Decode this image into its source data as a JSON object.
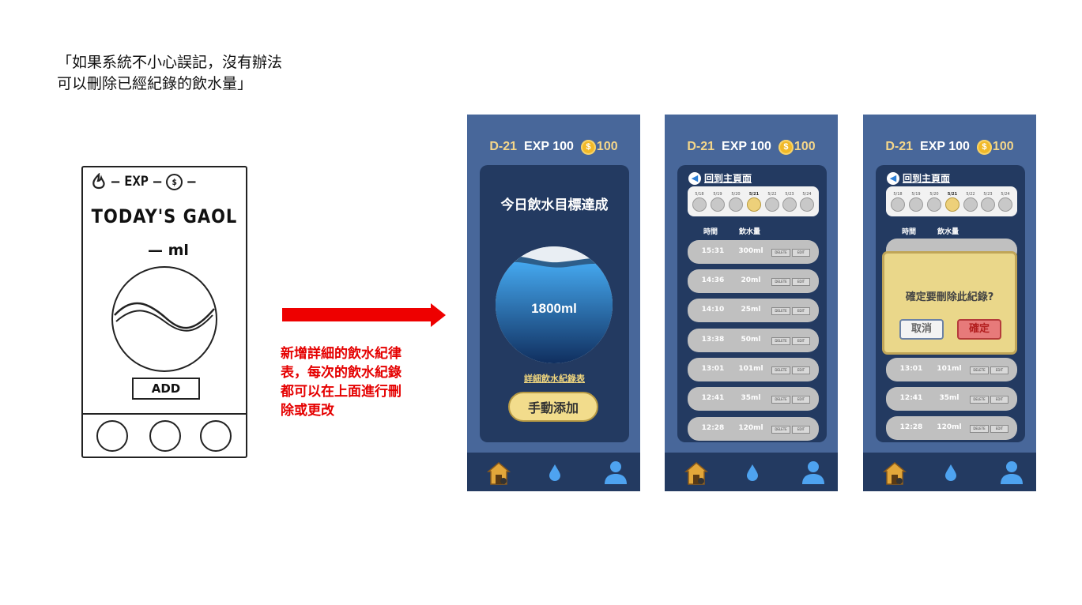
{
  "quote": "「如果系統不小心誤記，沒有辦法\n可以刪除已經紀錄的飲水量」",
  "sketch": {
    "top_bar": [
      "—",
      "EXP",
      "—",
      "—"
    ],
    "coin_symbol": "$",
    "title": "TODAY'S GAOL",
    "goal_unit": "— ml",
    "add_label": "ADD"
  },
  "note": "新增詳細的飲水紀律\n表，每次的飲水紀錄\n都可以在上面進行刪\n除或更改",
  "header": {
    "day": "D-21",
    "exp": "EXP 100",
    "coin_symbol": "$",
    "coins": "100"
  },
  "screen1": {
    "title": "今日飲水目標達成",
    "amount": "1800ml",
    "detail_link": "詳細飲水紀錄表",
    "add_button": "手動添加"
  },
  "records": {
    "back_label": "回到主頁面",
    "dates": [
      "5/18",
      "5/19",
      "5/20",
      "5/21",
      "5/22",
      "5/23",
      "5/24"
    ],
    "selected_date": "5/21",
    "col_time": "時間",
    "col_amount": "飲水量",
    "delete_label": "DELETE",
    "edit_label": "EDIT",
    "rows": [
      {
        "time": "15:31",
        "amount": "300ml"
      },
      {
        "time": "14:36",
        "amount": "20ml"
      },
      {
        "time": "14:10",
        "amount": "25ml"
      },
      {
        "time": "13:38",
        "amount": "50ml"
      },
      {
        "time": "13:01",
        "amount": "101ml"
      },
      {
        "time": "12:41",
        "amount": "35ml"
      },
      {
        "time": "12:28",
        "amount": "120ml"
      }
    ]
  },
  "dialog": {
    "message": "確定要刪除此紀錄?",
    "cancel": "取消",
    "confirm": "確定"
  },
  "colors": {
    "phone_bg": "#48679a",
    "card_bg": "#233a61",
    "gold": "#f4d68a",
    "arrow_red": "#ee0000"
  },
  "icons": [
    "fire-icon",
    "coin-icon",
    "home-icon",
    "water-drop-icon",
    "user-icon",
    "back-arrow-icon"
  ]
}
